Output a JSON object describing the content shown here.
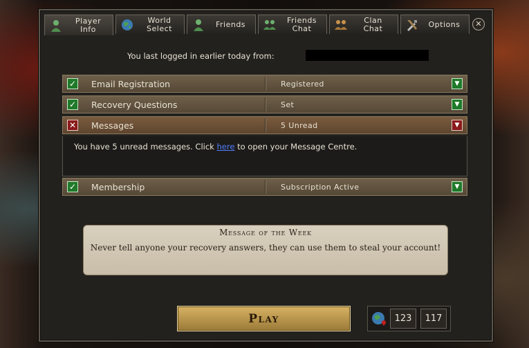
{
  "tabs": [
    {
      "label": "Player\nInfo",
      "icon": "player-icon",
      "active": true
    },
    {
      "label": "World\nSelect",
      "icon": "globe-icon"
    },
    {
      "label": "Friends",
      "icon": "friends-icon"
    },
    {
      "label": "Friends\nChat",
      "icon": "friends-chat-icon"
    },
    {
      "label": "Clan\nChat",
      "icon": "clan-icon"
    },
    {
      "label": "Options",
      "icon": "tools-icon"
    }
  ],
  "close_symbol": "✕",
  "last_login": {
    "text": "You last logged in earlier today from:"
  },
  "rows": [
    {
      "label": "Email Registration",
      "value": "Registered",
      "status": "ok"
    },
    {
      "label": "Recovery Questions",
      "value": "Set",
      "status": "ok"
    },
    {
      "label": "Messages",
      "value": "5 Unread",
      "status": "alert"
    },
    {
      "label": "Membership",
      "value": "Subscription Active",
      "status": "ok"
    }
  ],
  "messages_panel": {
    "before": "You have 5 unread messages. Click ",
    "link": "here",
    "after": " to open your Message Centre."
  },
  "motw": {
    "title": "Message of the Week",
    "text": "Never tell anyone your recovery answers, they can use them to steal your account!"
  },
  "play_label": "Play",
  "world": {
    "current": "123",
    "other": "117"
  },
  "colors": {
    "ok": "#1f7a2a",
    "alert": "#8a1a1a",
    "link": "#4f7fff"
  }
}
